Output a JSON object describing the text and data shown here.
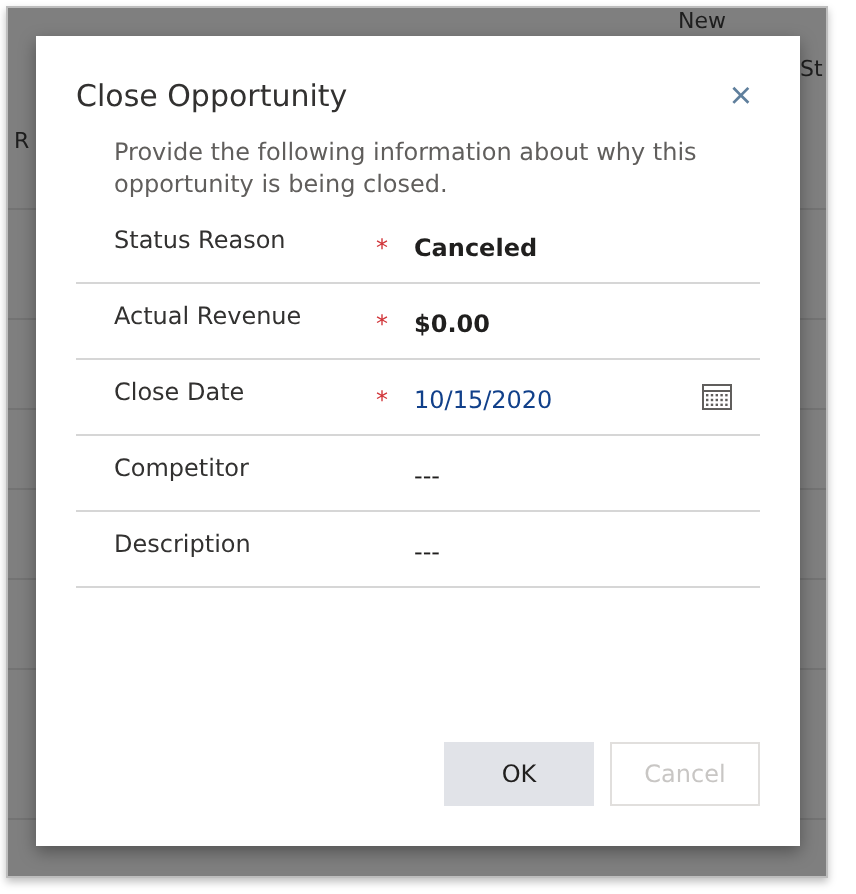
{
  "background": {
    "texts": [
      "New",
      "St",
      "R"
    ]
  },
  "dialog": {
    "title": "Close Opportunity",
    "close": "×",
    "description": "Provide the following information about why this opportunity is being closed.",
    "fields": [
      {
        "label": "Status Reason",
        "required": true,
        "value": "Canceled",
        "bold": true
      },
      {
        "label": "Actual Revenue",
        "required": true,
        "value": "$0.00",
        "bold": true
      },
      {
        "label": "Close Date",
        "required": true,
        "value": "10/15/2020",
        "bold": false,
        "kind": "date"
      },
      {
        "label": "Competitor",
        "required": false,
        "value": "---",
        "bold": false
      },
      {
        "label": "Description",
        "required": false,
        "value": "---",
        "bold": false
      }
    ],
    "required_mark": "*",
    "buttons": [
      {
        "label": "OK",
        "disabled": false
      },
      {
        "label": "Cancel",
        "disabled": true
      }
    ]
  }
}
